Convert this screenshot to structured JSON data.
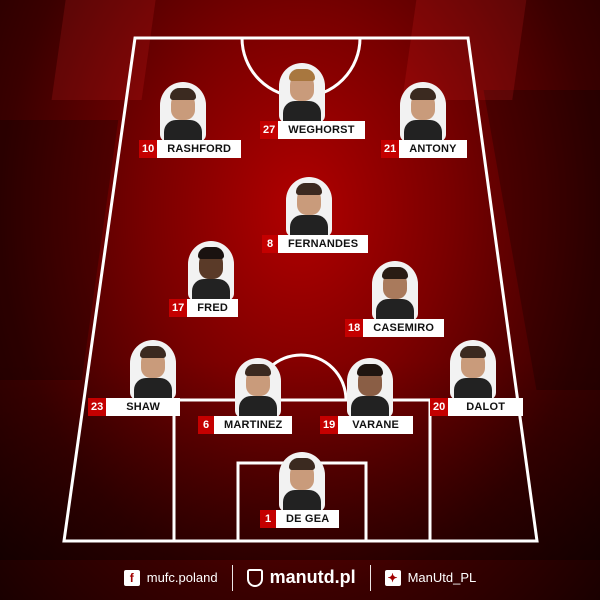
{
  "players": [
    {
      "number": "10",
      "name": "RASHFORD"
    },
    {
      "number": "27",
      "name": "WEGHORST"
    },
    {
      "number": "21",
      "name": "ANTONY"
    },
    {
      "number": "8",
      "name": "FERNANDES"
    },
    {
      "number": "17",
      "name": "FRED"
    },
    {
      "number": "18",
      "name": "CASEMIRO"
    },
    {
      "number": "23",
      "name": "SHAW"
    },
    {
      "number": "6",
      "name": "MARTINEZ"
    },
    {
      "number": "19",
      "name": "VARANE"
    },
    {
      "number": "20",
      "name": "DALOT"
    },
    {
      "number": "1",
      "name": "DE GEA"
    }
  ],
  "footer": {
    "facebook": "mufc.poland",
    "site": "manutd.pl",
    "twitter": "ManUtd_PL"
  },
  "icons": {
    "facebook": "facebook-icon",
    "site": "crest-icon",
    "twitter": "twitter-icon"
  }
}
